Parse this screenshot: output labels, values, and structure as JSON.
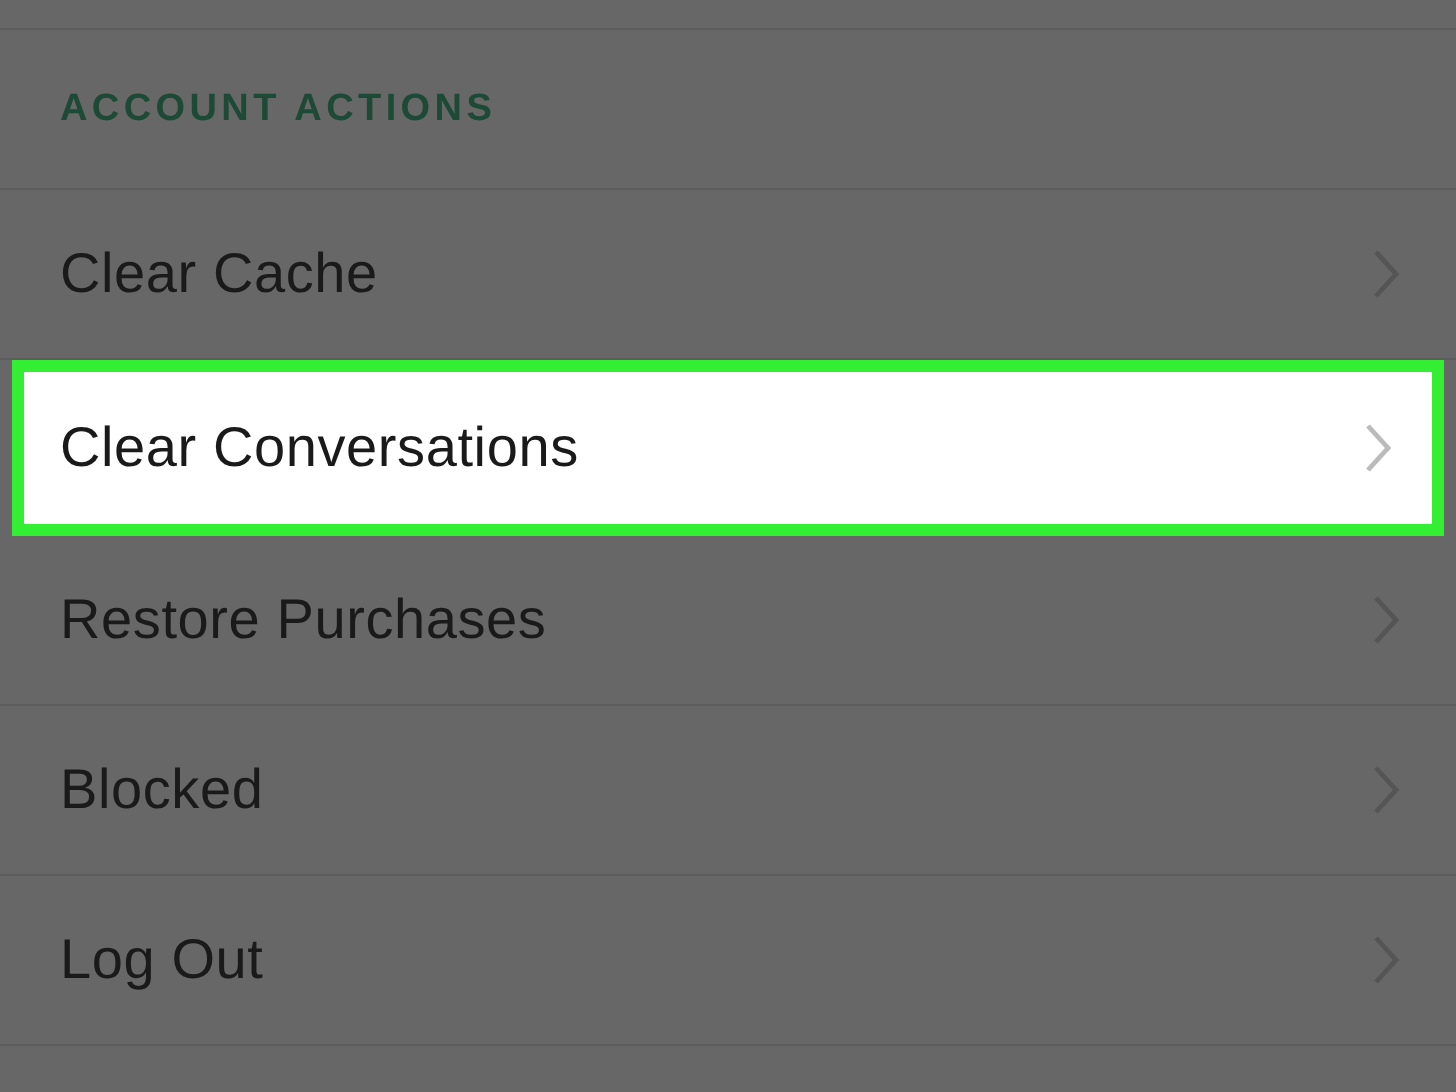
{
  "section": {
    "title": "ACCOUNT ACTIONS"
  },
  "rows": [
    {
      "label": "Clear Cache",
      "selected": false
    },
    {
      "label": "Clear Conversations",
      "selected": true
    },
    {
      "label": "Restore Purchases",
      "selected": false
    },
    {
      "label": "Blocked",
      "selected": false
    },
    {
      "label": "Log Out",
      "selected": false
    }
  ]
}
